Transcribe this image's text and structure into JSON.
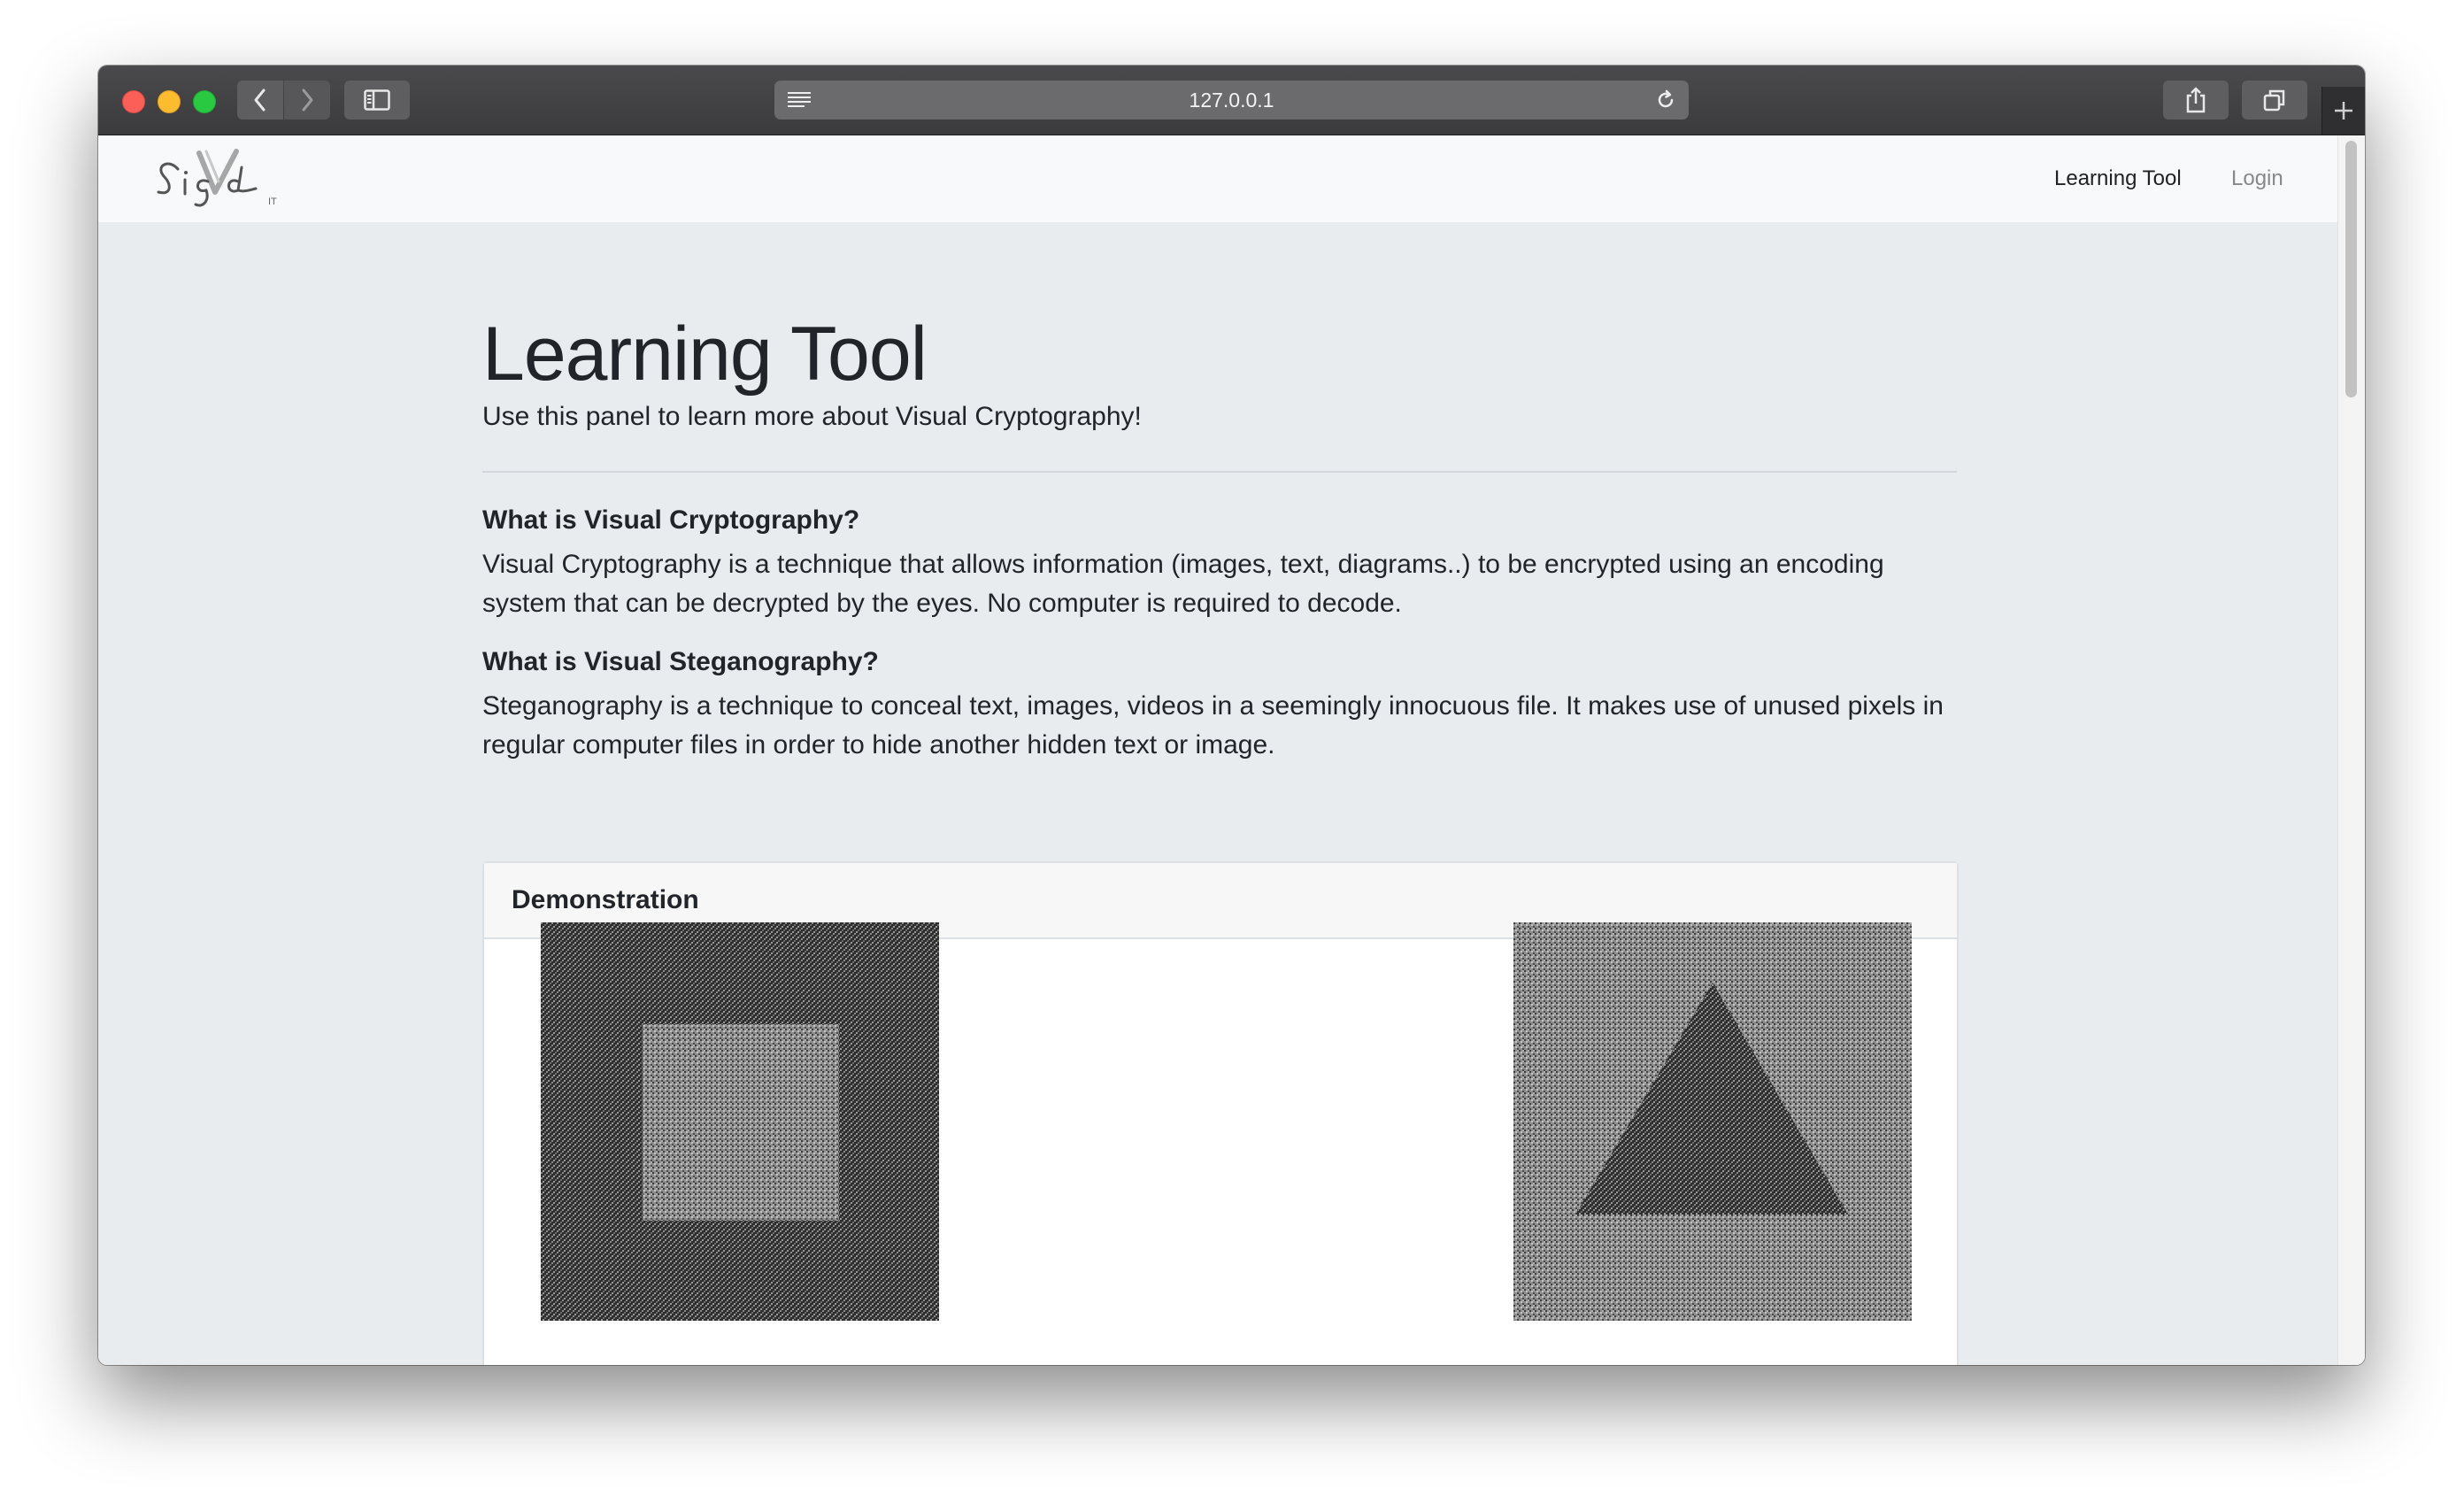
{
  "browser": {
    "url": "127.0.0.1",
    "icons": [
      "back-icon",
      "forward-icon",
      "sidebar-icon",
      "reader-icon",
      "reload-icon",
      "share-icon",
      "tabs-icon",
      "new-tab-icon"
    ]
  },
  "navbar": {
    "logo_text": "SigV",
    "logo_suffix": "IT",
    "links": [
      {
        "label": "Learning Tool",
        "active": true
      },
      {
        "label": "Login",
        "active": false
      }
    ]
  },
  "hero": {
    "title": "Learning Tool",
    "lead": "Use this panel to learn more about Visual Cryptography!"
  },
  "sections": [
    {
      "title": "What is Visual Cryptography?",
      "text": "Visual Cryptography is a technique that allows information (images, text, diagrams..) to be encrypted using an encoding system that can be decrypted by the eyes. No computer is required to decode."
    },
    {
      "title": "What is Visual Steganography?",
      "text": "Steganography is a technique to conceal text, images, videos in a seemingly innocuous file. It makes use of unused pixels in regular computer files in order to hide another hidden text or image."
    }
  ],
  "demo": {
    "header": "Demonstration",
    "images": [
      {
        "name": "share-square",
        "hidden_shape": "square"
      },
      {
        "name": "share-triangle",
        "hidden_shape": "triangle"
      }
    ]
  }
}
